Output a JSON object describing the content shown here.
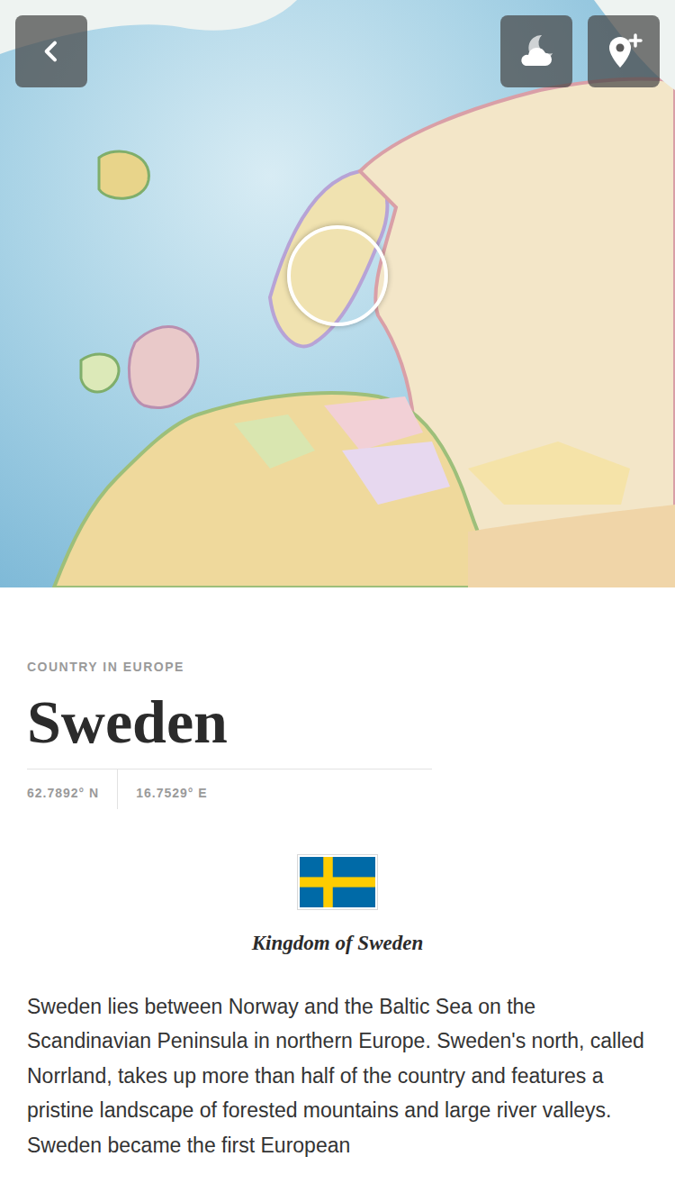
{
  "header": {
    "buttons": [
      {
        "name": "back",
        "label": "‹"
      },
      {
        "name": "weather"
      },
      {
        "name": "add-place"
      }
    ]
  },
  "country": {
    "category": "COUNTRY IN EUROPE",
    "name": "Sweden",
    "latitude": "62.7892° N",
    "longitude": "16.7529° E",
    "official_name": "Kingdom of Sweden",
    "description": "Sweden lies between Norway and the Baltic Sea on the Scandinavian Peninsula in northern Europe. Sweden's north, called Norrland, takes up more than half of the country and features a pristine landscape of forested mountains and large river valleys. Sweden became the first European"
  }
}
